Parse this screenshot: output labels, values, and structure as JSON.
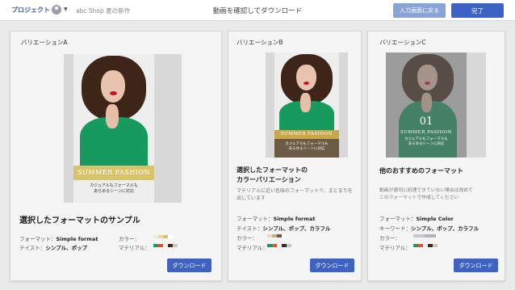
{
  "header": {
    "project_label": "プロジェクト",
    "caret": "▼",
    "shop_name": "abc Shop 夏の新作",
    "page_title": "動画を確認してダウンロード",
    "back_label": "入力画面に戻る",
    "done_label": "完了"
  },
  "colors": {
    "accent": "#3d62c4",
    "accent_light": "#8aa3d9",
    "card_bg": "#f5f5f5",
    "shirt_green": "#169a5e",
    "gold": "#d9c36a",
    "brown": "#6b5a44"
  },
  "cards": [
    {
      "title": "バリエーションA",
      "banner_title": "SUMMER FASHION",
      "banner_text": [
        "カジュアルもフォーマルも",
        "あらゆるシーンに対応"
      ],
      "heading": "選択したフォーマットのサンプル",
      "format_label": "フォーマット：",
      "format_value": "Simple format",
      "taste_label": "テイスト：",
      "taste_value": "シンプル、ポップ",
      "color_label": "カラー：",
      "material_label": "マテリアル：",
      "swatches_color": [
        "#f3ecd9",
        "#ead9a8",
        "#d9c36a",
        "#ffffff"
      ],
      "swatches_material": [
        "#169a5e",
        "#e0552a",
        "#f0f0f0",
        "#3a2a20",
        "#c7c7c7"
      ],
      "download_label": "ダウンロード"
    },
    {
      "title": "バリエーションB",
      "banner_title": "SUMMER FASHION",
      "banner_text": [
        "カジュアルもフォーマルも",
        "あらゆるシーンに対応"
      ],
      "heading_lines": [
        "選択したフォーマットの",
        "カラーバリエーション"
      ],
      "desc_lines": [
        "マテリアルに近い色味のフォーマットで、まとまりを",
        "出しています"
      ],
      "format_label": "フォーマット：",
      "format_value": "Simple format",
      "taste_label": "テイスト：",
      "taste_value": "シンプル、ポップ、カラフル",
      "color_label": "カラー：",
      "material_label": "マテリアル：",
      "swatches_color": [
        "#e8dcc0",
        "#c9b27a",
        "#6b5a44",
        "#ffffff"
      ],
      "swatches_material": [
        "#169a5e",
        "#e0552a",
        "#f0f0f0",
        "#3a2a20",
        "#c7c7c7"
      ],
      "download_label": "ダウンロード"
    },
    {
      "title": "バリエーションC",
      "banner_num": "01",
      "banner_title": "SUMMER FASHION",
      "banner_text": [
        "カジュアルもフォーマルも",
        "あらゆるシーンに対応"
      ],
      "heading": "他のおすすめのフォーマット",
      "desc_lines": [
        "動画が適切に処理できていない場合は改めて",
        "このフォーマットで作成してください"
      ],
      "format_label": "フォーマット：",
      "format_value": "Simple Color",
      "keyword_label": "キーワード：",
      "keyword_value": "シンプル、ポップ、カラフル",
      "color_label": "カラー：",
      "material_label": "マテリアル：",
      "swatches_color": [
        "#c9c9c9",
        "#b3b3b3"
      ],
      "swatches_material": [
        "#169a5e",
        "#e0552a",
        "#f0f0f0",
        "#3a2a20",
        "#c7c7c7"
      ],
      "download_label": "ダウンロード"
    }
  ]
}
